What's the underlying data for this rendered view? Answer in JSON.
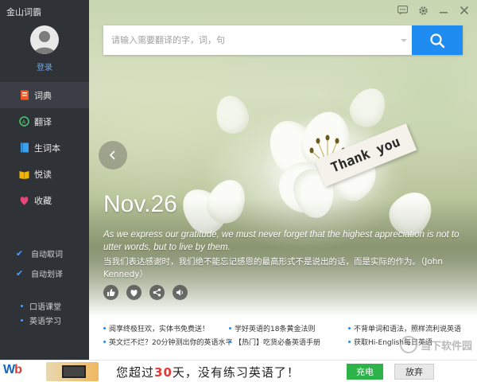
{
  "app": {
    "title": "金山词霸"
  },
  "user": {
    "login_label": "登录"
  },
  "sidebar": {
    "nav": [
      {
        "label": "词典",
        "icon": "dictionary-icon",
        "color": "#f05a28",
        "active": true
      },
      {
        "label": "翻译",
        "icon": "translate-icon",
        "color": "#3ecf6a",
        "active": false
      },
      {
        "label": "生词本",
        "icon": "vocab-book-icon",
        "color": "#3aa0f0",
        "active": false
      },
      {
        "label": "悦读",
        "icon": "reading-icon",
        "color": "#f5b400",
        "active": false
      },
      {
        "label": "收藏",
        "icon": "heart-icon",
        "color": "#e8457c",
        "active": false
      }
    ],
    "options": [
      {
        "label": "自动取词",
        "checked": true
      },
      {
        "label": "自动划译",
        "checked": true
      }
    ],
    "links": [
      {
        "label": "口语课堂"
      },
      {
        "label": "英语学习"
      }
    ]
  },
  "search": {
    "placeholder": "请输入需要翻译的字，词，句"
  },
  "daily": {
    "date": "Nov.26",
    "image_tag": "Thank you",
    "quote_en": "As we express our gratitude, we must never forget that the highest appreciation is not to utter words, but to live by them.",
    "quote_zh": "当我们表达感谢时，我们绝不能忘记感恩的最高形式不是说出的话，而是实际的作为。（John Kennedy）"
  },
  "news": [
    {
      "label": "阅享终极狂欢，实体书免费送！"
    },
    {
      "label": "学好英语的18条黄金法则"
    },
    {
      "label": "不背单词和语法，照样流利说英语"
    },
    {
      "label": "英文烂不烂？20分钟测出你的英语水平"
    },
    {
      "label": "【热门】吃货必备英语手册"
    },
    {
      "label": "获取Hi-English每日英语"
    }
  ],
  "watermark": {
    "text": "当下软件园"
  },
  "ad": {
    "logo_a": "W",
    "logo_b": "b",
    "text_before": "您超过",
    "days": "30",
    "text_after": "天，没有练习英语了！",
    "recharge_label": "充电",
    "cancel_label": "放弃"
  },
  "colors": {
    "accent": "#1e8cf0",
    "recharge": "#2db34a",
    "ad_highlight": "#e53935"
  }
}
